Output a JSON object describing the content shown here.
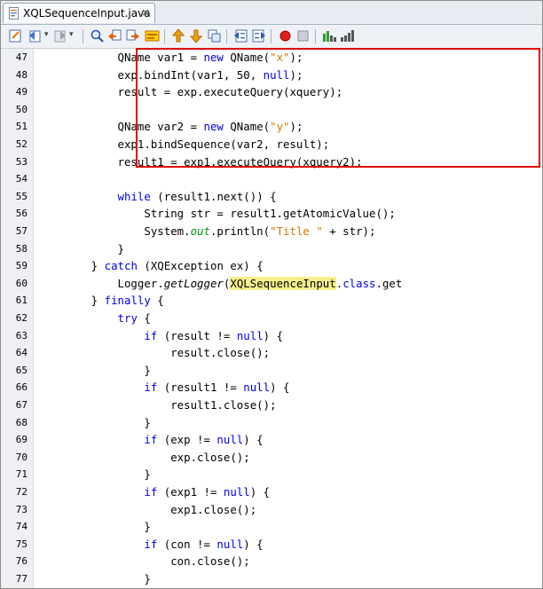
{
  "tab": {
    "title": "XQLSequenceInput.java",
    "close": "×"
  },
  "lines": [
    {
      "n": "47",
      "segs": [
        {
          "t": "            QName var1 = "
        },
        {
          "t": "new",
          "k": "kw"
        },
        {
          "t": " QName("
        },
        {
          "t": "\"x\"",
          "k": "str"
        },
        {
          "t": ");"
        }
      ]
    },
    {
      "n": "48",
      "segs": [
        {
          "t": "            exp.bindInt(var1, 50, "
        },
        {
          "t": "null",
          "k": "kw"
        },
        {
          "t": ");"
        }
      ]
    },
    {
      "n": "49",
      "segs": [
        {
          "t": "            result = exp.executeQuery(xquery);"
        }
      ]
    },
    {
      "n": "50",
      "segs": [
        {
          "t": ""
        }
      ]
    },
    {
      "n": "51",
      "segs": [
        {
          "t": "            QName var2 = "
        },
        {
          "t": "new",
          "k": "kw"
        },
        {
          "t": " QName("
        },
        {
          "t": "\"y\"",
          "k": "str"
        },
        {
          "t": ");"
        }
      ]
    },
    {
      "n": "52",
      "segs": [
        {
          "t": "            exp1.bindSequence(var2, result);"
        }
      ]
    },
    {
      "n": "53",
      "segs": [
        {
          "t": "            result1 = exp1.executeQuery(xquery2);"
        }
      ]
    },
    {
      "n": "54",
      "segs": [
        {
          "t": ""
        }
      ]
    },
    {
      "n": "55",
      "segs": [
        {
          "t": "            "
        },
        {
          "t": "while",
          "k": "kw"
        },
        {
          "t": " (result1.next()) {"
        }
      ]
    },
    {
      "n": "56",
      "segs": [
        {
          "t": "                String str = result1.getAtomicValue();"
        }
      ]
    },
    {
      "n": "57",
      "segs": [
        {
          "t": "                System."
        },
        {
          "t": "out",
          "k": "sfield"
        },
        {
          "t": ".println("
        },
        {
          "t": "\"Title \"",
          "k": "str"
        },
        {
          "t": " + str);"
        }
      ]
    },
    {
      "n": "58",
      "segs": [
        {
          "t": "            }"
        }
      ]
    },
    {
      "n": "59",
      "segs": [
        {
          "t": "        } "
        },
        {
          "t": "catch",
          "k": "kw"
        },
        {
          "t": " (XQException ex) {"
        }
      ]
    },
    {
      "n": "60",
      "segs": [
        {
          "t": "            Logger."
        },
        {
          "t": "getLogger",
          "k": "it"
        },
        {
          "t": "("
        },
        {
          "t": "XQLSequenceInput",
          "k": "hl"
        },
        {
          "t": "."
        },
        {
          "t": "class",
          "k": "kw"
        },
        {
          "t": ".get"
        }
      ]
    },
    {
      "n": "61",
      "segs": [
        {
          "t": "        } "
        },
        {
          "t": "finally",
          "k": "kw"
        },
        {
          "t": " {"
        }
      ]
    },
    {
      "n": "62",
      "segs": [
        {
          "t": "            "
        },
        {
          "t": "try",
          "k": "kw"
        },
        {
          "t": " {"
        }
      ]
    },
    {
      "n": "63",
      "segs": [
        {
          "t": "                "
        },
        {
          "t": "if",
          "k": "kw"
        },
        {
          "t": " (result != "
        },
        {
          "t": "null",
          "k": "kw"
        },
        {
          "t": ") {"
        }
      ]
    },
    {
      "n": "64",
      "segs": [
        {
          "t": "                    result.close();"
        }
      ]
    },
    {
      "n": "65",
      "segs": [
        {
          "t": "                }"
        }
      ]
    },
    {
      "n": "66",
      "segs": [
        {
          "t": "                "
        },
        {
          "t": "if",
          "k": "kw"
        },
        {
          "t": " (result1 != "
        },
        {
          "t": "null",
          "k": "kw"
        },
        {
          "t": ") {"
        }
      ]
    },
    {
      "n": "67",
      "segs": [
        {
          "t": "                    result1.close();"
        }
      ]
    },
    {
      "n": "68",
      "segs": [
        {
          "t": "                }"
        }
      ]
    },
    {
      "n": "69",
      "segs": [
        {
          "t": "                "
        },
        {
          "t": "if",
          "k": "kw"
        },
        {
          "t": " (exp != "
        },
        {
          "t": "null",
          "k": "kw"
        },
        {
          "t": ") {"
        }
      ]
    },
    {
      "n": "70",
      "segs": [
        {
          "t": "                    exp.close();"
        }
      ]
    },
    {
      "n": "71",
      "segs": [
        {
          "t": "                }"
        }
      ]
    },
    {
      "n": "72",
      "segs": [
        {
          "t": "                "
        },
        {
          "t": "if",
          "k": "kw"
        },
        {
          "t": " (exp1 != "
        },
        {
          "t": "null",
          "k": "kw"
        },
        {
          "t": ") {"
        }
      ]
    },
    {
      "n": "73",
      "segs": [
        {
          "t": "                    exp1.close();"
        }
      ]
    },
    {
      "n": "74",
      "segs": [
        {
          "t": "                }"
        }
      ]
    },
    {
      "n": "75",
      "segs": [
        {
          "t": "                "
        },
        {
          "t": "if",
          "k": "kw"
        },
        {
          "t": " (con != "
        },
        {
          "t": "null",
          "k": "kw"
        },
        {
          "t": ") {"
        }
      ]
    },
    {
      "n": "76",
      "segs": [
        {
          "t": "                    con.close();"
        }
      ]
    },
    {
      "n": "77",
      "segs": [
        {
          "t": "                }"
        }
      ]
    }
  ],
  "colors": {
    "keyword": "#0000e6",
    "string": "#ce7b00",
    "static_field": "#009900",
    "highlight": "#f3f08b",
    "annotation_box": "#e00000"
  },
  "icons": [
    "last-edit-icon",
    "back-icon",
    "forward-icon",
    "find-selection-icon",
    "find-previous-icon",
    "find-next-icon",
    "toggle-highlight-icon",
    "previous-bookmark-icon",
    "next-bookmark-icon",
    "toggle-bookmark-icon",
    "shift-left-icon",
    "shift-right-icon",
    "start-macro-icon",
    "stop-macro-icon",
    "comment-icon",
    "uncomment-icon"
  ]
}
